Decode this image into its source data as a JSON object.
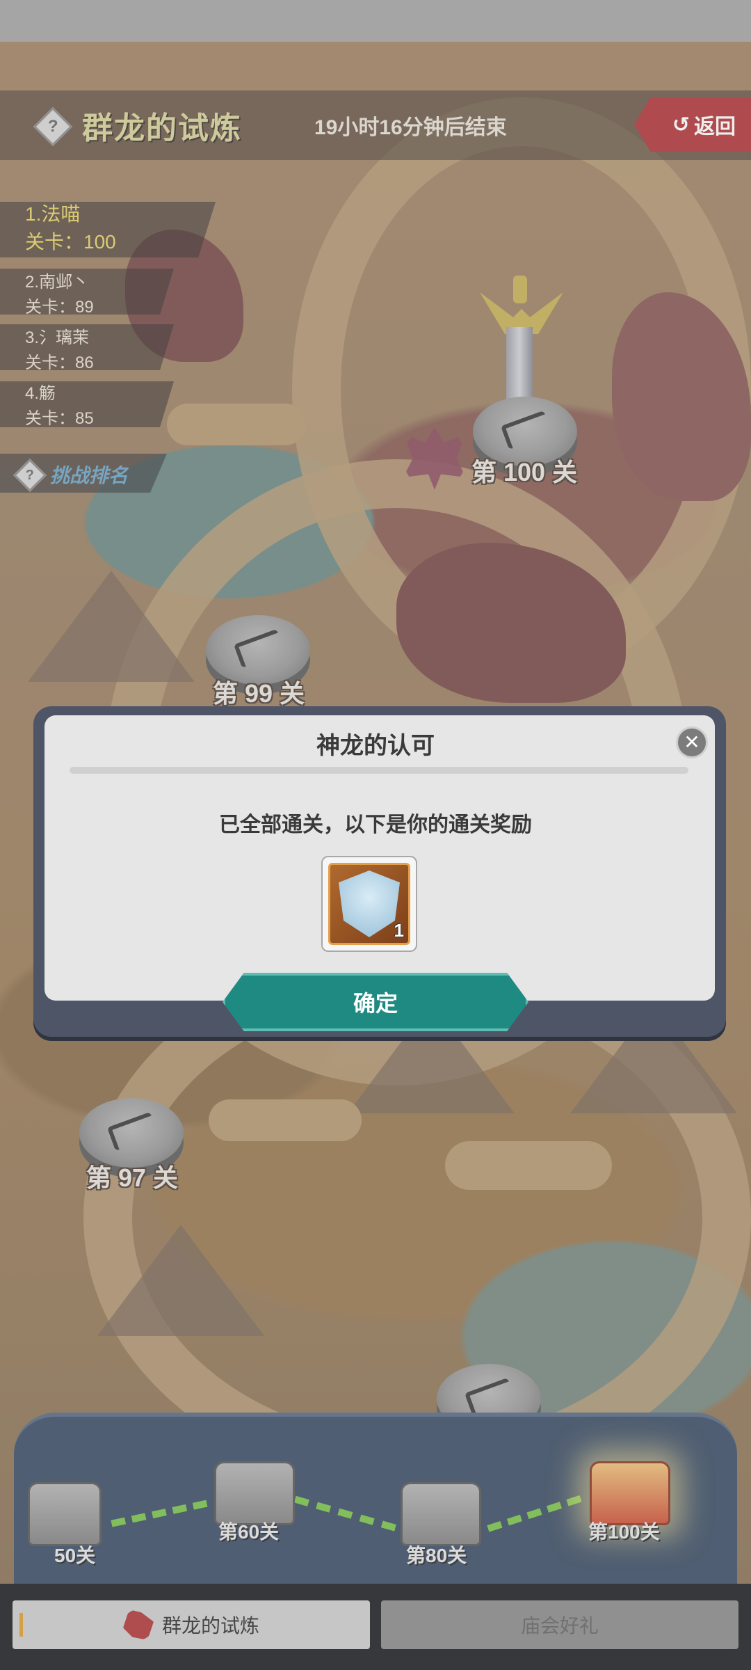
{
  "header": {
    "event_title": "群龙的试炼",
    "timer": "19小时16分钟后结束",
    "back_label": "返回",
    "help_glyph": "?"
  },
  "ranking": {
    "entries": [
      {
        "name": "1.法喵",
        "stage": "关卡：100"
      },
      {
        "name": "2.南邺丶",
        "stage": "关卡：89"
      },
      {
        "name": "3.氵璃茉",
        "stage": "关卡：86"
      },
      {
        "name": "4.觞",
        "stage": "关卡：85"
      }
    ],
    "challenge_rank_label": "挑战排名"
  },
  "levels": {
    "level_100": "第 100 关",
    "level_99": "第 99 关",
    "level_97": "第 97 关"
  },
  "modal": {
    "title": "神龙的认可",
    "message": "已全部通关，以下是你的通关奖励",
    "reward_count": "1",
    "confirm_label": "确定",
    "close_glyph": "✕"
  },
  "milestones": {
    "m50": "50关",
    "m60": "第60关",
    "m80": "第80关",
    "m100": "第100关"
  },
  "tabs": {
    "trial": "群龙的试炼",
    "gift": "庙会好礼"
  },
  "colors": {
    "accent_teal": "#1f8a82",
    "back_red": "#b3393c",
    "title_yellow": "#d9d49a",
    "progress_green": "#7cc54c"
  }
}
